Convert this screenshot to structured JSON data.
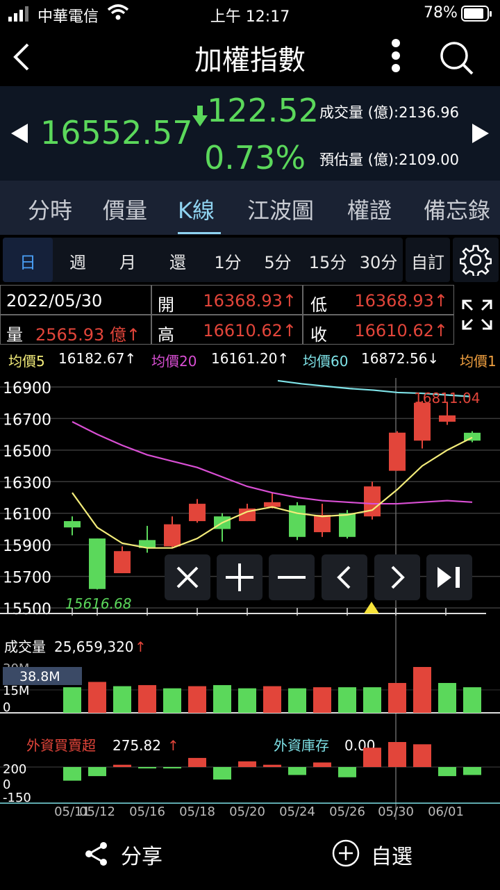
{
  "status": {
    "carrier": "中華電信",
    "time": "上午 12:17",
    "battery": "78%"
  },
  "nav": {
    "title": "加權指數"
  },
  "quote": {
    "price": "16552.57",
    "change": "122.52",
    "change_pct": "0.73%",
    "volume_label": "成交量 (億):2136.96",
    "est_label": "預估量 (億):2109.00"
  },
  "tabs": [
    "分時",
    "價量",
    "K線",
    "江波圖",
    "權證",
    "備忘錄"
  ],
  "periods": [
    "日",
    "週",
    "月",
    "還",
    "1分",
    "5分",
    "15分",
    "30分",
    "自訂"
  ],
  "info": {
    "date": "2022/05/30",
    "open_label": "開",
    "open": "16368.93↑",
    "low_label": "低",
    "low": "16368.93↑",
    "vol_label": "量",
    "vol": "2565.93 億↑",
    "high_label": "高",
    "high": "16610.62↑",
    "close_label": "收",
    "close": "16610.62↑"
  },
  "ma": {
    "ma5_label": "均價5",
    "ma5": "16182.67↑",
    "ma20_label": "均價20",
    "ma20": "16161.20↑",
    "ma60_label": "均價60",
    "ma60": "16872.56↓",
    "ma_cut": "均價1"
  },
  "colors": {
    "up": "#e2453a",
    "down": "#5bd85b",
    "ma5": "#f3ec7a",
    "ma20": "#d94fd4",
    "ma60": "#7fe3e8"
  },
  "chart_data": {
    "type": "candlestick",
    "y_ticks": [
      "16900",
      "16700",
      "16500",
      "16300",
      "16100",
      "15900",
      "15700",
      "15500"
    ],
    "ylim": [
      15500,
      16950
    ],
    "high_marker": "16811.04",
    "low_marker": "15616.68",
    "x_ticks": [
      "05/11",
      "05/12",
      "05/16",
      "05/18",
      "05/20",
      "05/24",
      "05/26",
      "05/30",
      "06/01"
    ],
    "candles": [
      {
        "o": 16050,
        "c": 16010,
        "h": 16080,
        "l": 15960
      },
      {
        "o": 15940,
        "c": 15620,
        "h": 15940,
        "l": 15616.68
      },
      {
        "o": 15720,
        "c": 15860,
        "h": 15890,
        "l": 15720
      },
      {
        "o": 15930,
        "c": 15880,
        "h": 16020,
        "l": 15850
      },
      {
        "o": 15890,
        "c": 16030,
        "h": 16080,
        "l": 15880
      },
      {
        "o": 16050,
        "c": 16160,
        "h": 16190,
        "l": 16040
      },
      {
        "o": 16080,
        "c": 16000,
        "h": 16100,
        "l": 15920
      },
      {
        "o": 16050,
        "c": 16130,
        "h": 16160,
        "l": 16050
      },
      {
        "o": 16140,
        "c": 16170,
        "h": 16230,
        "l": 16130
      },
      {
        "o": 16150,
        "c": 15950,
        "h": 16170,
        "l": 15930
      },
      {
        "o": 15980,
        "c": 16090,
        "h": 16160,
        "l": 15950
      },
      {
        "o": 16100,
        "c": 15950,
        "h": 16120,
        "l": 15940
      },
      {
        "o": 16080,
        "c": 16270,
        "h": 16300,
        "l": 16060
      },
      {
        "o": 16368.93,
        "c": 16610.62,
        "h": 16620,
        "l": 16368.93
      },
      {
        "o": 16560,
        "c": 16800,
        "h": 16811.04,
        "l": 16510
      },
      {
        "o": 16680,
        "c": 16720,
        "h": 16800,
        "l": 16660
      },
      {
        "o": 16610,
        "c": 16560,
        "h": 16620,
        "l": 16550
      }
    ],
    "ma5": [
      16230,
      16010,
      15910,
      15880,
      15880,
      15940,
      16040,
      16110,
      16140,
      16100,
      16080,
      16090,
      16120,
      16250,
      16400,
      16500,
      16580
    ],
    "ma20": [
      16680,
      16600,
      16530,
      16470,
      16430,
      16390,
      16330,
      16270,
      16230,
      16200,
      16180,
      16170,
      16160,
      16160,
      16170,
      16180,
      16170
    ],
    "ma60_start": 8,
    "ma60": [
      16940,
      16920,
      16905,
      16890,
      16880,
      16865,
      16860,
      16850,
      16840
    ],
    "volume": {
      "label": "成交量",
      "value": "25,659,320↑",
      "box": "38.8M",
      "ticks": [
        "30M",
        "15M",
        "0"
      ],
      "max": 35,
      "bars": [
        {
          "v": 24,
          "up": false
        },
        {
          "v": 29,
          "up": true
        },
        {
          "v": 25,
          "up": false
        },
        {
          "v": 26,
          "up": true
        },
        {
          "v": 23,
          "up": false
        },
        {
          "v": 25,
          "up": true
        },
        {
          "v": 26,
          "up": false
        },
        {
          "v": 23,
          "up": false
        },
        {
          "v": 25,
          "up": true
        },
        {
          "v": 23,
          "up": false
        },
        {
          "v": 24,
          "up": true
        },
        {
          "v": 24,
          "up": false
        },
        {
          "v": 24,
          "up": false
        },
        {
          "v": 28,
          "up": true
        },
        {
          "v": 43,
          "up": true
        },
        {
          "v": 28,
          "up": false
        },
        {
          "v": 24,
          "up": false
        }
      ]
    },
    "foreign": {
      "label": "外資買賣超",
      "value": "275.82↑",
      "stock_label": "外資庫存",
      "stock_value": "0.00",
      "ticks": [
        "200",
        "0",
        "-150"
      ],
      "bars": [
        -120,
        -80,
        20,
        -10,
        -10,
        80,
        -110,
        50,
        20,
        -70,
        40,
        -90,
        170,
        220,
        200,
        -80,
        -70
      ]
    }
  },
  "toolbar_icons": [
    "close-icon",
    "plus-icon",
    "minus-icon",
    "chevron-left-icon",
    "chevron-right-icon",
    "skip-end-icon"
  ],
  "bottom": {
    "share": "分享",
    "watch": "自選"
  }
}
